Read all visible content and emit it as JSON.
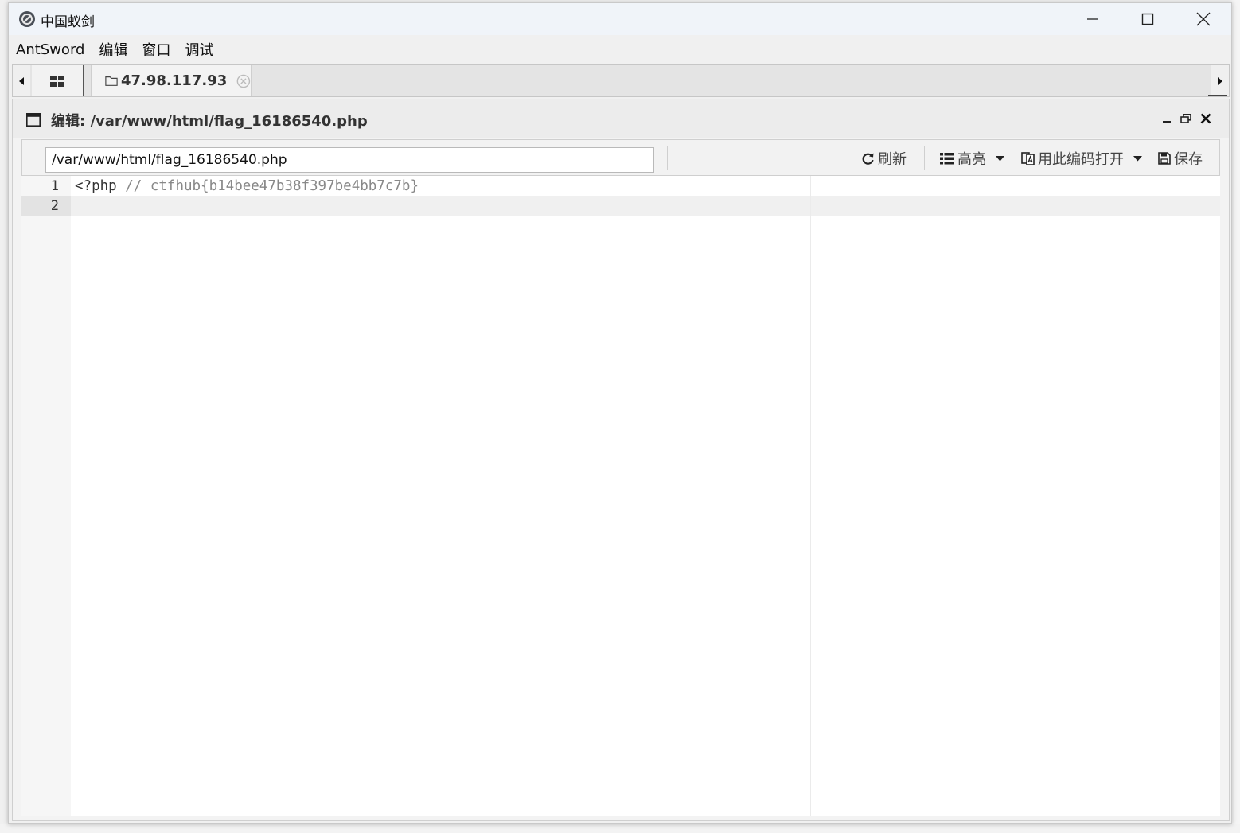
{
  "window": {
    "title": "中国蚁剑"
  },
  "menu": [
    "AntSword",
    "编辑",
    "窗口",
    "调试"
  ],
  "tabs": {
    "host": "47.98.117.93"
  },
  "panel": {
    "title": "编辑: /var/www/html/flag_16186540.php"
  },
  "toolbar": {
    "path_value": "/var/www/html/flag_16186540.php",
    "refresh": "刷新",
    "highlight": "高亮",
    "open_with_encoding": "用此编码打开",
    "save": "保存"
  },
  "editor": {
    "line_numbers": [
      "1",
      "2"
    ],
    "line1_keyword": "<?php",
    "line1_comment": "// ctfhub{b14bee47b38f397be4bb7c7b}"
  }
}
